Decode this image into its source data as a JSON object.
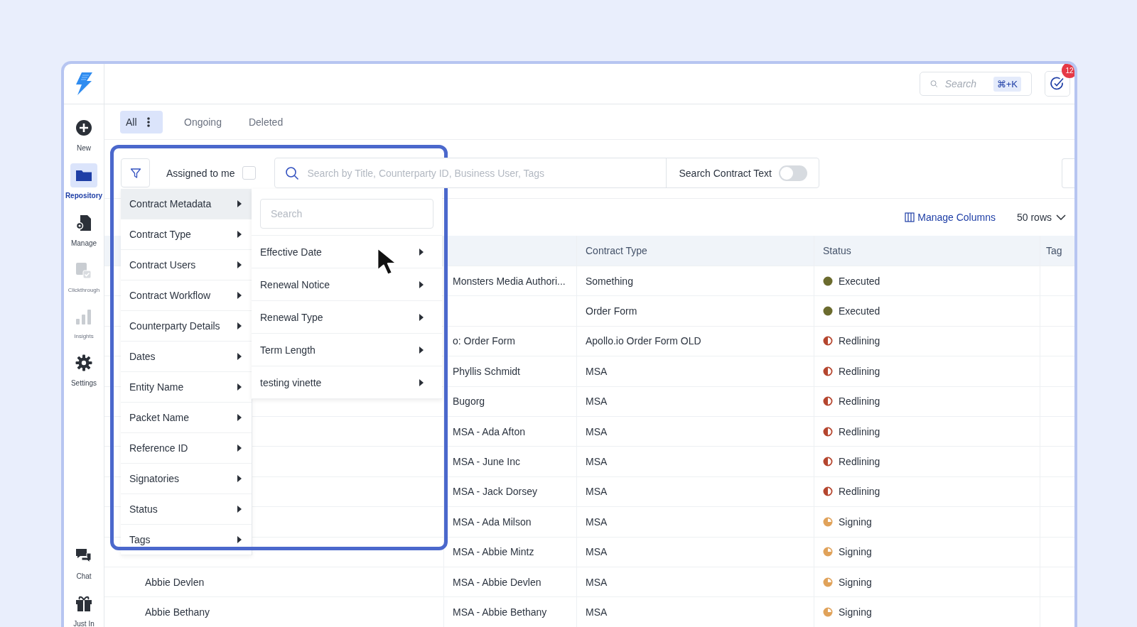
{
  "header": {
    "search": {
      "placeholder": "Search",
      "shortcut": "⌘+K"
    },
    "notifications": {
      "count": "12"
    }
  },
  "sidebar": {
    "items": [
      {
        "label": "New",
        "kind": "new",
        "selected": false,
        "disabled": false
      },
      {
        "label": "Repository",
        "kind": "repository",
        "selected": true,
        "disabled": false
      },
      {
        "label": "Manage",
        "kind": "manage",
        "selected": false,
        "disabled": false
      },
      {
        "label": "Clickthrough",
        "kind": "clickthrough",
        "selected": false,
        "disabled": true
      },
      {
        "label": "Insights",
        "kind": "insights",
        "selected": false,
        "disabled": true
      },
      {
        "label": "Settings",
        "kind": "settings",
        "selected": false,
        "disabled": false
      }
    ],
    "bottom_items": [
      {
        "label": "Chat",
        "kind": "chat",
        "selected": false,
        "disabled": false
      },
      {
        "label": "Just In",
        "kind": "gift",
        "selected": false,
        "disabled": false
      }
    ]
  },
  "tabs": [
    {
      "label": "All",
      "selected": true,
      "menu": true
    },
    {
      "label": "Ongoing",
      "selected": false,
      "menu": false
    },
    {
      "label": "Deleted",
      "selected": false,
      "menu": false
    }
  ],
  "toolbar": {
    "assigned_to_me": {
      "label": "Assigned to me",
      "checked": false
    },
    "search": {
      "placeholder": "Search by Title, Counterparty ID, Business User, Tags"
    },
    "contract_text": {
      "label": "Search Contract Text",
      "on": false
    }
  },
  "list_options": {
    "manage_columns": "Manage Columns",
    "rows": "50 rows"
  },
  "table": {
    "columns": [
      "Contract Type",
      "Status",
      "Tag"
    ],
    "rows": [
      {
        "document": "Monsters Media Authori...",
        "contract_type": "Something",
        "status": {
          "label": "Executed",
          "kind": "executed",
          "color": "#6b6b2e"
        }
      },
      {
        "contract_type": "Order Form",
        "status": {
          "label": "Executed",
          "kind": "executed",
          "color": "#6b6b2e"
        }
      },
      {
        "document": "o: Order Form",
        "contract_type": "Apollo.io Order Form OLD",
        "status": {
          "label": "Redlining",
          "kind": "redlining",
          "color": "#b5462f"
        }
      },
      {
        "document": "Phyllis Schmidt",
        "contract_type": "MSA",
        "status": {
          "label": "Redlining",
          "kind": "redlining",
          "color": "#b5462f"
        }
      },
      {
        "document": "Bugorg",
        "contract_type": "MSA",
        "status": {
          "label": "Redlining",
          "kind": "redlining",
          "color": "#b5462f"
        }
      },
      {
        "document": "MSA - Ada Afton",
        "contract_type": "MSA",
        "status": {
          "label": "Redlining",
          "kind": "redlining",
          "color": "#b5462f"
        }
      },
      {
        "document": "MSA - June Inc",
        "contract_type": "MSA",
        "status": {
          "label": "Redlining",
          "kind": "redlining",
          "color": "#b5462f"
        }
      },
      {
        "document": "MSA - Jack Dorsey",
        "contract_type": "MSA",
        "status": {
          "label": "Redlining",
          "kind": "redlining",
          "color": "#b5462f"
        }
      },
      {
        "document": "MSA - Ada Milson",
        "contract_type": "MSA",
        "status": {
          "label": "Signing",
          "kind": "signing",
          "color": "#e0a25a"
        }
      },
      {
        "document": "MSA - Abbie Mintz",
        "contract_type": "MSA",
        "status": {
          "label": "Signing",
          "kind": "signing",
          "color": "#e0a25a"
        }
      },
      {
        "title": "Abbie Devlen",
        "document": "MSA - Abbie Devlen",
        "contract_type": "MSA",
        "status": {
          "label": "Signing",
          "kind": "signing",
          "color": "#e0a25a"
        }
      },
      {
        "title": "Abbie Bethany",
        "document": "MSA - Abbie Bethany",
        "contract_type": "MSA",
        "status": {
          "label": "Signing",
          "kind": "signing",
          "color": "#e0a25a"
        }
      }
    ]
  },
  "filter_menu": {
    "items": [
      {
        "label": "Contract Metadata",
        "selected": true
      },
      {
        "label": "Contract Type",
        "selected": false
      },
      {
        "label": "Contract Users",
        "selected": false
      },
      {
        "label": "Contract Workflow",
        "selected": false
      },
      {
        "label": "Counterparty Details",
        "selected": false
      },
      {
        "label": "Dates",
        "selected": false
      },
      {
        "label": "Entity Name",
        "selected": false
      },
      {
        "label": "Packet Name",
        "selected": false
      },
      {
        "label": "Reference ID",
        "selected": false
      },
      {
        "label": "Signatories",
        "selected": false
      },
      {
        "label": "Status",
        "selected": false
      },
      {
        "label": "Tags",
        "selected": false
      }
    ],
    "submenu": {
      "search": {
        "placeholder": "Search"
      },
      "items": [
        {
          "label": "Effective Date"
        },
        {
          "label": "Renewal Notice"
        },
        {
          "label": "Renewal Type"
        },
        {
          "label": "Term Length"
        },
        {
          "label": "testing vinette"
        }
      ]
    }
  }
}
